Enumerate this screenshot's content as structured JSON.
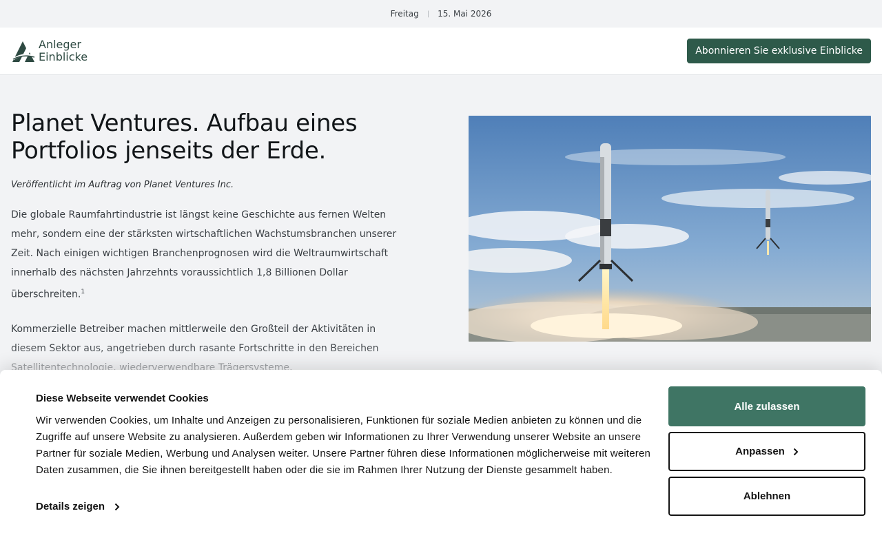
{
  "topbar": {
    "day": "Freitag",
    "separator": "|",
    "date": "15. Mai 2026"
  },
  "header": {
    "logo_line1": "Anleger",
    "logo_line2": "Einblicke",
    "subscribe_label": "Abonnieren Sie exklusive Einblicke"
  },
  "article": {
    "title": "Planet Ventures. Aufbau eines Portfolios jenseits der Erde.",
    "byline": "Veröffentlicht im Auftrag von Planet Ventures Inc.",
    "para1": "Die globale Raumfahrtindustrie ist längst keine Geschichte aus fernen Welten mehr, sondern eine der stärksten wirtschaftlichen Wachstumsbranchen unserer Zeit. Nach einigen wichtigen Branchenprognosen wird die Weltraumwirtschaft innerhalb des nächsten Jahrzehnts voraussichtlich 1,8 Billionen Dollar überschreiten.",
    "para1_footnote": "1",
    "para2": "Kommerzielle Betreiber machen mittlerweile den Großteil der Aktivitäten in diesem Sektor aus, angetrieben durch rasante Fortschritte in den Bereichen Satellitentechnologie, wiederverwendbare Trägersysteme, Breitbandkonstellationen, Erdbeobachtung, Verteidigungsanwendungen und Initiativen zur Erforschung des"
  },
  "cookie": {
    "title": "Diese Webseite verwendet Cookies",
    "body": "Wir verwenden Cookies, um Inhalte und Anzeigen zu personalisieren, Funktionen für soziale Medien anbieten zu können und die Zugriffe auf unsere Website zu analysieren. Außerdem geben wir Informationen zu Ihrer Verwendung unserer Website an unsere Partner für soziale Medien, Werbung und Analysen weiter. Unsere Partner führen diese Informationen möglicherweise mit weiteren Daten zusammen, die Sie ihnen bereitgestellt haben oder die sie im Rahmen Ihrer Nutzung der Dienste gesammelt haben.",
    "details_label": "Details zeigen",
    "allow_all_label": "Alle zulassen",
    "customize_label": "Anpassen",
    "decline_label": "Ablehnen"
  },
  "colors": {
    "brand": "#2e5a4a",
    "accept": "#3f7564"
  },
  "icons": {
    "logo": "logo-a-icon",
    "chevron": "chevron-right-icon"
  }
}
